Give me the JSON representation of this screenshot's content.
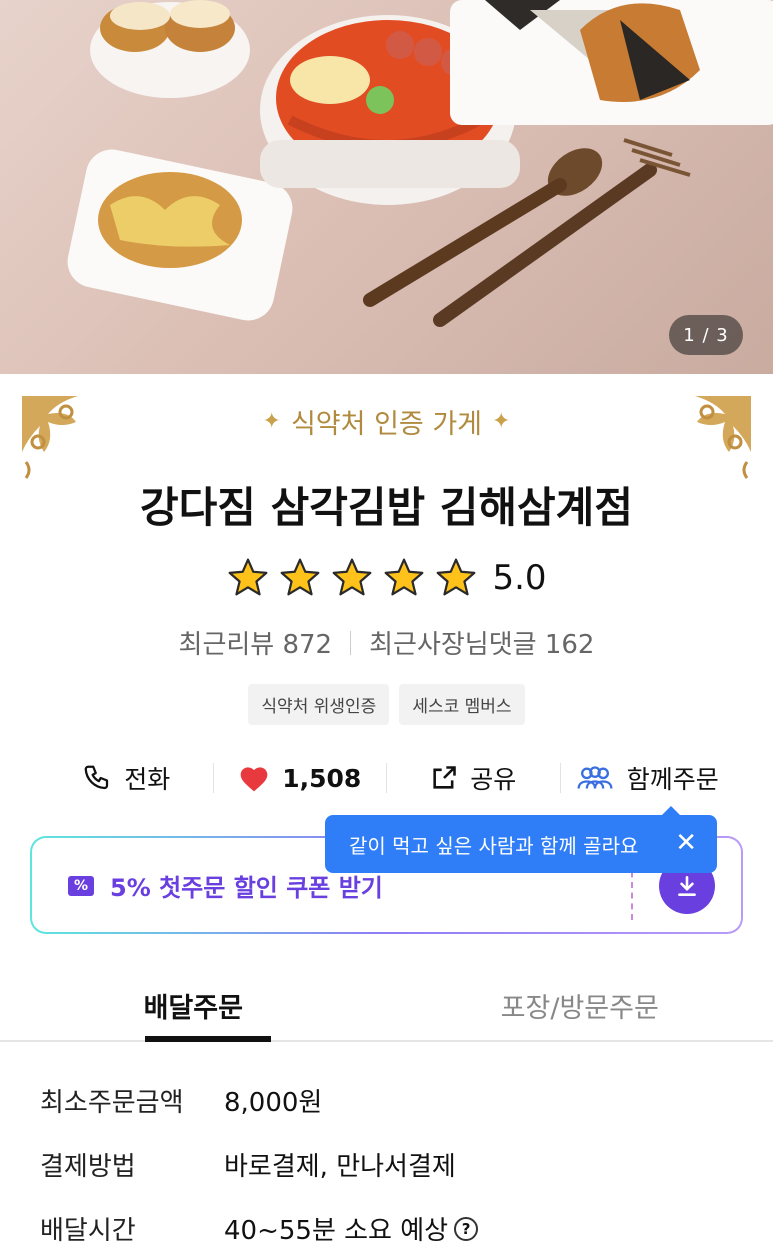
{
  "hero": {
    "counter": "1 / 3"
  },
  "store": {
    "certification": "식약처 인증 가게",
    "name": "강다짐 삼각김밥 김해삼계점",
    "rating": "5.0",
    "stars": 5,
    "recent_reviews": "최근리뷰 872",
    "owner_replies": "최근사장님댓글 162",
    "badges": [
      "식약처 위생인증",
      "세스코 멤버스"
    ]
  },
  "actions": {
    "call": "전화",
    "likes": "1,508",
    "share": "공유",
    "group_order": "함께주문"
  },
  "tooltip": {
    "text": "같이 먹고 싶은 사람과 함께 골라요",
    "close": "✕"
  },
  "coupon": {
    "label": "5% 첫주문 할인 쿠폰 받기"
  },
  "tabs": [
    "배달주문",
    "포장/방문주문"
  ],
  "info": [
    {
      "label": "최소주문금액",
      "value": "8,000원"
    },
    {
      "label": "결제방법",
      "value": "바로결제, 만나서결제"
    },
    {
      "label": "배달시간",
      "value": "40~55분 소요 예상"
    }
  ],
  "colors": {
    "accent_gold": "#b08a3e",
    "accent_purple": "#6a3fe0",
    "tooltip_blue": "#2f7ef7",
    "group_icon_blue": "#3b6fe0"
  }
}
